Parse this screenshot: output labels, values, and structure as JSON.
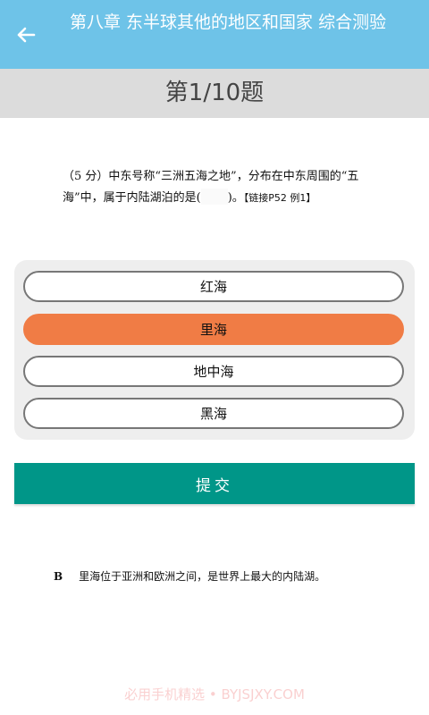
{
  "header": {
    "title": "第八章 东半球其他的地区和国家  综合测验"
  },
  "question_header": {
    "label": "第1/10题"
  },
  "question": {
    "part1": "（5 分）中东号称“三洲五海之地”，分布在中东周围的“五海”中，属于内陆湖泊的是(",
    "part2": ")。",
    "ref": "【链接P52 例1】"
  },
  "options": [
    {
      "label": "红海",
      "selected": false
    },
    {
      "label": "里海",
      "selected": true
    },
    {
      "label": "地中海",
      "selected": false
    },
    {
      "label": "黑海",
      "selected": false
    }
  ],
  "submit_label": "提交",
  "answer": {
    "letter": "B",
    "explanation": "里海位于亚洲和欧洲之间，是世界上最大的内陆湖。"
  },
  "watermark": "必用手机精选 • BYJSJXY.COM",
  "colors": {
    "topbar": "#6ec3e8",
    "selected_option": "#f07c45",
    "submit": "#009688"
  },
  "icons": {
    "back": "arrow-left-icon"
  }
}
